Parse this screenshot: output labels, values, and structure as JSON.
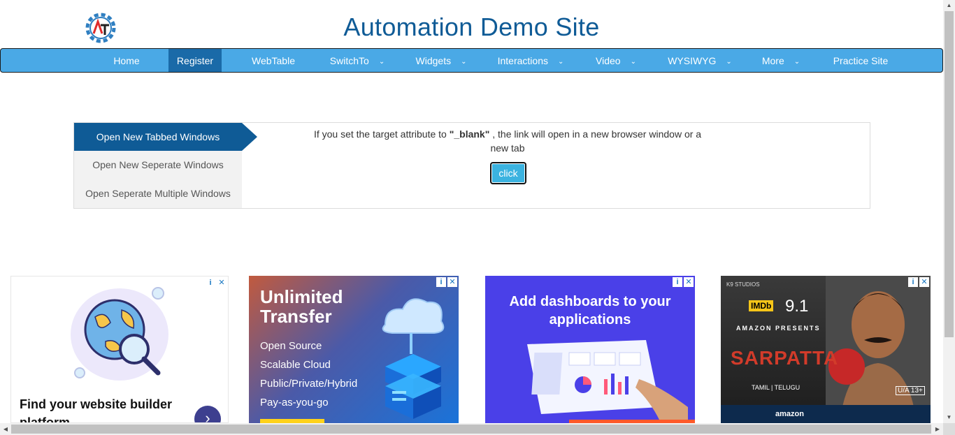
{
  "header": {
    "title": "Automation Demo Site"
  },
  "nav": {
    "items": [
      {
        "label": "Home"
      },
      {
        "label": "Register"
      },
      {
        "label": "WebTable"
      },
      {
        "label": "SwitchTo"
      },
      {
        "label": "Widgets"
      },
      {
        "label": "Interactions"
      },
      {
        "label": "Video"
      },
      {
        "label": "WYSIWYG"
      },
      {
        "label": "More"
      },
      {
        "label": "Practice Site"
      }
    ],
    "active": "Register",
    "dropdown_icon": "chevron-down-icon"
  },
  "windows": {
    "tabs": [
      {
        "label": "Open New Tabbed Windows"
      },
      {
        "label": "Open New Seperate Windows"
      },
      {
        "label": "Open Seperate Multiple Windows"
      }
    ],
    "active_tab": "Open New Tabbed Windows",
    "description_pre": "If you set the target attribute to ",
    "description_bold": "\"_blank\"",
    "description_post": " , the link will open in a new browser window or a new tab",
    "button_label": "click"
  },
  "ads": {
    "ad1": {
      "headline": "Find your website builder platform"
    },
    "ad2": {
      "title": "Unlimited Transfer",
      "items": [
        "Open Source",
        "Scalable Cloud",
        "Public/Private/Hybrid",
        "Pay-as-you-go"
      ]
    },
    "ad3": {
      "title": "Add dashboards to your applications"
    },
    "ad4": {
      "studio": "K9 STUDIOS",
      "imdb": "IMDb",
      "rating": "9.1",
      "presents": "AMAZON PRESENTS",
      "movie": "SARPATTA",
      "languages": "TAMIL | TELUGU",
      "cert": "U/A 13+",
      "brand": "amazon"
    },
    "info_icon": "info-icon",
    "close_icon": "close-icon"
  },
  "colors": {
    "title": "#0f5b96",
    "navbar": "#4aa9e6",
    "nav_active": "#1a6aa8",
    "tab_active": "#0f5b96",
    "button": "#3bb3e0"
  }
}
